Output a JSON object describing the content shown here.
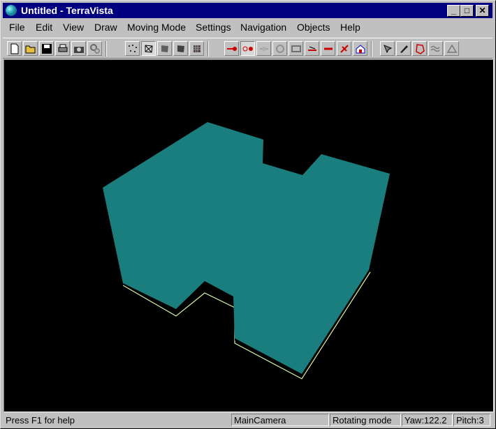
{
  "window": {
    "title": "Untitled - TerraVista",
    "minimize": "_",
    "maximize": "□",
    "close": "✕"
  },
  "menu": [
    "File",
    "Edit",
    "View",
    "Draw",
    "Moving Mode",
    "Settings",
    "Navigation",
    "Objects",
    "Help"
  ],
  "toolbar": {
    "groups": [
      [
        "new-file-icon",
        "open-folder-icon",
        "save-disk-icon",
        "print-icon",
        "camera-snapshot-icon",
        "settings-gears-icon"
      ],
      [
        "points-icon",
        "wireframe-icon",
        "flat-shade-icon",
        "solid-shade-icon",
        "texture-icon"
      ],
      [
        "path-start-icon",
        "path-point-icon",
        "path-link-icon",
        "path-orbit-icon",
        "path-frame-icon",
        "path-fly-icon",
        "path-jump-icon",
        "path-wing-icon",
        "home-icon"
      ],
      [
        "object-select-icon",
        "object-brush-icon",
        "polygon-icon",
        "terrain-waves-icon",
        "terrain-edit-icon"
      ]
    ],
    "pressed": [
      "wireframe-icon",
      "path-point-icon"
    ]
  },
  "viewport": {
    "background": "#000000",
    "model_color": "#1a7d7e",
    "outline_color": "#d4f5a0"
  },
  "status": {
    "help": "Press F1 for help",
    "camera": "MainCamera",
    "mode": "Rotating mode",
    "yaw": "Yaw:122.2",
    "pitch": "Pitch:3"
  }
}
